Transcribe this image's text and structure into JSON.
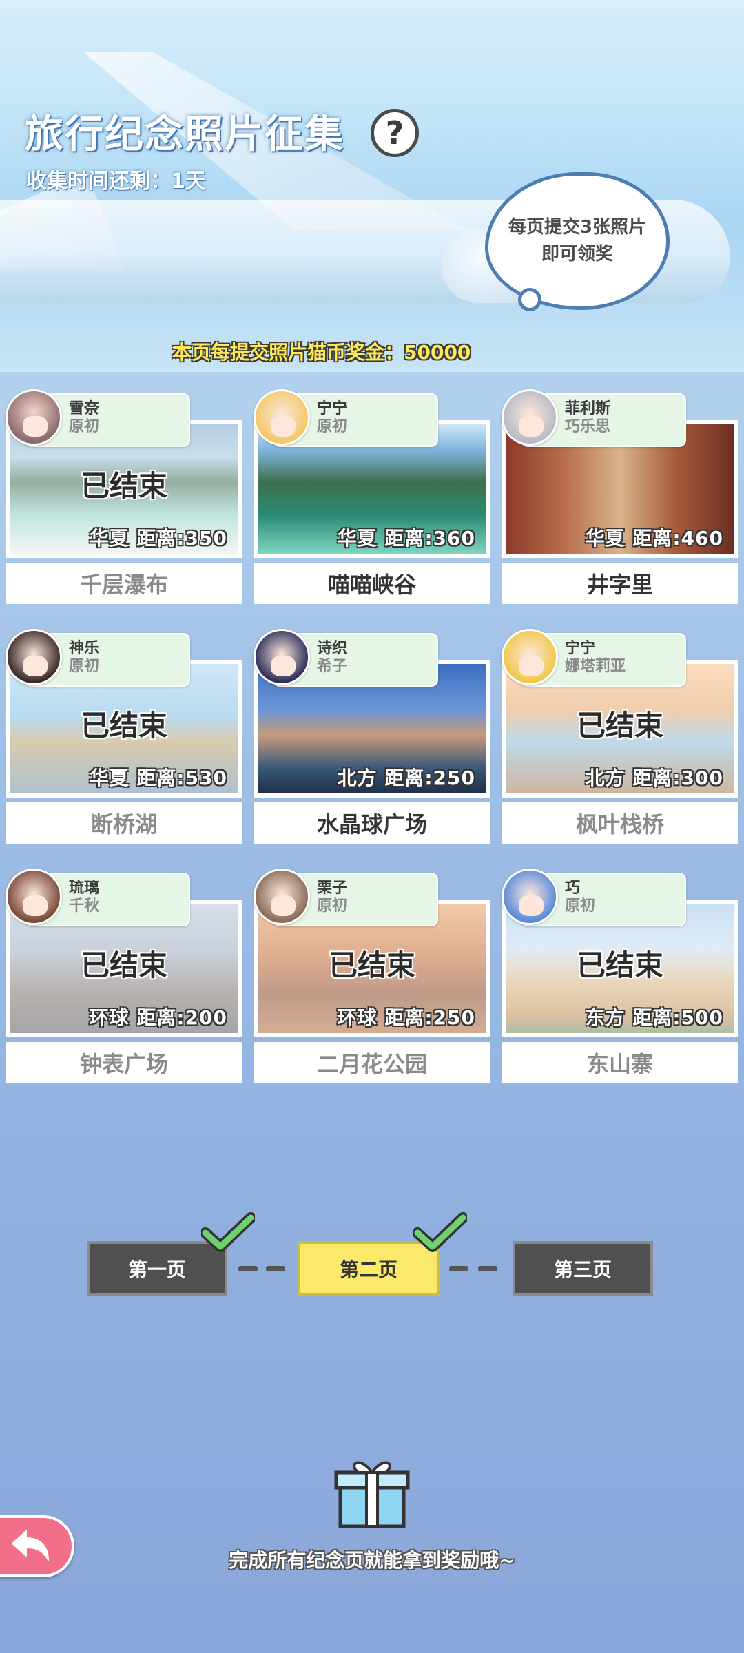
{
  "header": {
    "title": "旅行纪念照片征集",
    "help_icon": "?",
    "countdown": "收集时间还剩：1天",
    "bubble_line1": "每页提交3张照片",
    "bubble_line2": "即可领奖",
    "bonus": "本页每提交照片猫币奖金：50000"
  },
  "cards": [
    {
      "tag_name": "雪奈",
      "tag_sub": "原初",
      "status": "已结束",
      "region_dist": "华夏 距离:350",
      "place": "千层瀑布"
    },
    {
      "tag_name": "宁宁",
      "tag_sub": "原初",
      "status": "",
      "region_dist": "华夏 距离:360",
      "place": "喵喵峡谷"
    },
    {
      "tag_name": "菲利斯",
      "tag_sub": "巧乐思",
      "status": "",
      "region_dist": "华夏 距离:460",
      "place": "井字里"
    },
    {
      "tag_name": "神乐",
      "tag_sub": "原初",
      "status": "已结束",
      "region_dist": "华夏 距离:530",
      "place": "断桥湖"
    },
    {
      "tag_name": "诗织",
      "tag_sub": "希子",
      "status": "",
      "region_dist": "北方 距离:250",
      "place": "水晶球广场"
    },
    {
      "tag_name": "宁宁",
      "tag_sub": "娜塔莉亚",
      "status": "已结束",
      "region_dist": "北方 距离:300",
      "place": "枫叶栈桥"
    },
    {
      "tag_name": "琉璃",
      "tag_sub": "千秋",
      "status": "已结束",
      "region_dist": "环球 距离:200",
      "place": "钟表广场"
    },
    {
      "tag_name": "栗子",
      "tag_sub": "原初",
      "status": "已结束",
      "region_dist": "环球 距离:250",
      "place": "二月花公园"
    },
    {
      "tag_name": "巧",
      "tag_sub": "原初",
      "status": "已结束",
      "region_dist": "东方 距离:500",
      "place": "东山寨"
    }
  ],
  "pager": {
    "page1": "第一页",
    "page2": "第二页",
    "page3": "第三页"
  },
  "bottom": {
    "note": "完成所有纪念页就能拿到奖励哦~"
  },
  "icons": {
    "help": "question-mark-icon",
    "check": "check-icon",
    "gift": "gift-icon",
    "back": "back-arrow-icon"
  },
  "colors": {
    "active_page": "#fbe96a",
    "inactive_page": "#505050",
    "back_button": "#f26f8a",
    "check_green": "#6fd16f"
  }
}
